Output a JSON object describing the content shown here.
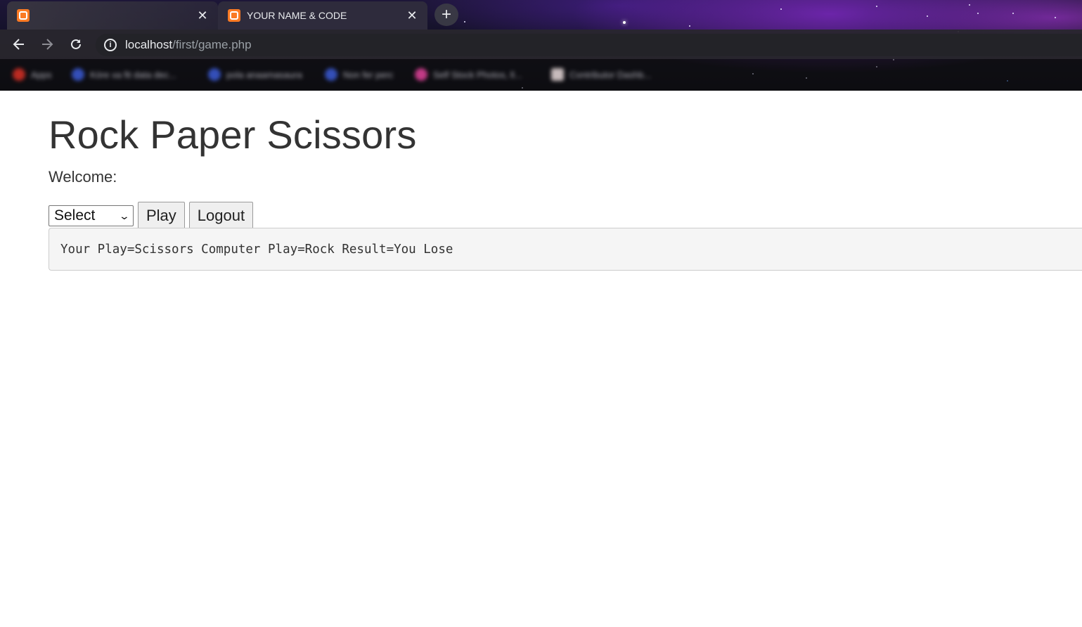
{
  "browser": {
    "tabs": [
      {
        "title": "",
        "active": false,
        "favicon": "xampp-icon"
      },
      {
        "title": "YOUR NAME & CODE",
        "active": true,
        "favicon": "xampp-icon"
      }
    ],
    "new_tab_label": "+",
    "url_host": "localhost",
    "url_path": "/first/game.php",
    "bookmarks": [
      {
        "label": "Apps",
        "color": "#d93025"
      },
      {
        "label": "Kóre xa fit data dec...",
        "color": "#3b5bd6"
      },
      {
        "label": "pola anaamasaura",
        "color": "#3b5bd6"
      },
      {
        "label": "Non fer perc",
        "color": "#3b5bd6"
      },
      {
        "label": "Self Stock Photos, ll...",
        "color": "#e2429a"
      },
      {
        "label": "Contributor Dashb...",
        "color": "#e7d9d9"
      }
    ]
  },
  "page": {
    "heading": "Rock Paper Scissors",
    "welcome": "Welcome:",
    "select": {
      "selected": "Select"
    },
    "play_label": "Play",
    "logout_label": "Logout",
    "result": "Your Play=Scissors Computer Play=Rock Result=You Lose"
  },
  "colors": {
    "text": "#333333",
    "result_bg": "#f5f5f5",
    "xampp_orange": "#fb7a24"
  }
}
